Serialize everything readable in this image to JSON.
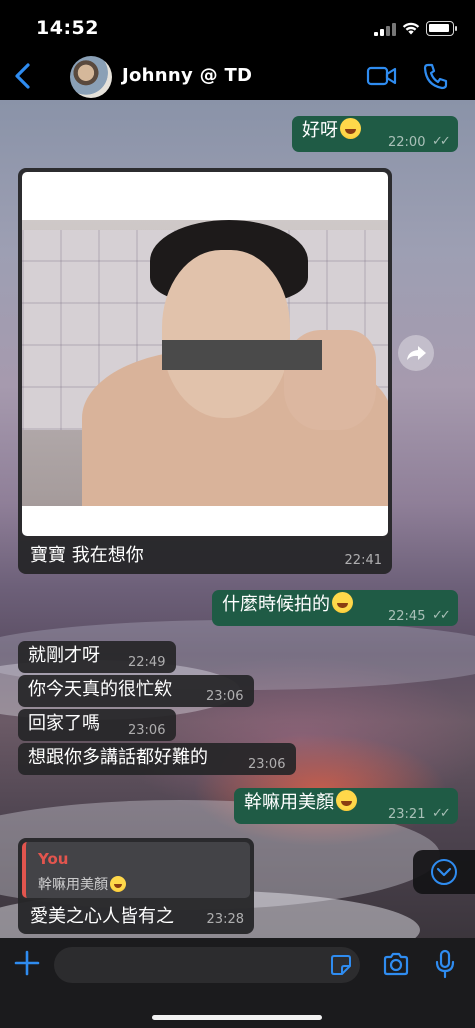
{
  "status_bar": {
    "time": "14:52"
  },
  "header": {
    "contact_name": "Johnny  @ TD"
  },
  "messages": [
    {
      "direction": "out",
      "text": "好呀",
      "emoji": "smiling-face-with-hearts",
      "time": "22:00"
    },
    {
      "direction": "in",
      "type": "image",
      "caption": "寶寶 我在想你",
      "time": "22:41"
    },
    {
      "direction": "out",
      "text": "什麼時候拍的",
      "emoji": "tears-of-joy",
      "time": "22:45"
    },
    {
      "direction": "in",
      "text": "就剛才呀",
      "time": "22:49"
    },
    {
      "direction": "in",
      "text": "你今天真的很忙欸",
      "time": "23:06"
    },
    {
      "direction": "in",
      "text": "回家了嗎",
      "time": "23:06"
    },
    {
      "direction": "in",
      "text": "想跟你多講話都好難的",
      "time": "23:06"
    },
    {
      "direction": "out",
      "text": "幹嘛用美顏",
      "emoji": "tears-of-joy",
      "time": "23:21"
    },
    {
      "direction": "in",
      "quote": {
        "author": "You",
        "text": "幹嘛用美顏",
        "emoji": "tears-of-joy"
      },
      "text": "愛美之心人皆有之",
      "time": "23:28"
    }
  ],
  "icons": {
    "back": "chevron-left-icon",
    "video": "video-camera-icon",
    "call": "phone-icon",
    "forward": "forward-icon",
    "scroll_down": "chevron-down-icon",
    "plus": "plus-icon",
    "sticker": "sticker-icon",
    "camera": "camera-icon",
    "mic": "microphone-icon"
  },
  "colors": {
    "accent": "#2f8cf0",
    "outgoing_bubble": "#1f5b45",
    "incoming_bubble": "#262628",
    "quote_accent": "#e2554e"
  }
}
